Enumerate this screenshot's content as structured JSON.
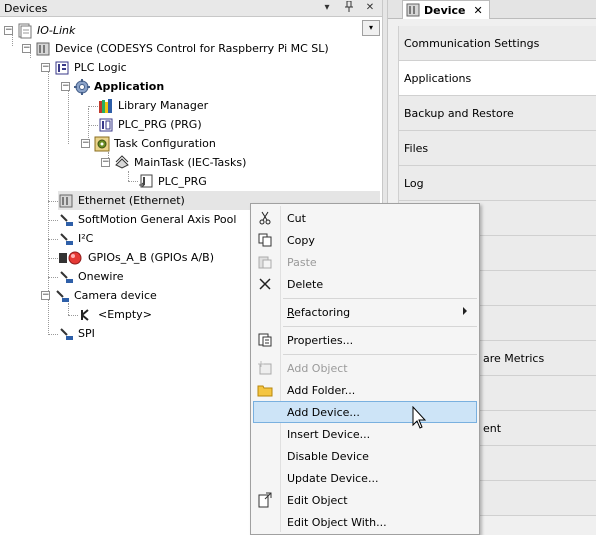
{
  "pane": {
    "title": "Devices",
    "dropdown_glyph": "▾",
    "btn_pin": "▾",
    "btn_dock": "⊥",
    "btn_close": "✕"
  },
  "tree": {
    "root": "IO-Link",
    "device": "Device (CODESYS Control for Raspberry Pi MC SL)",
    "plc_logic": "PLC Logic",
    "application": "Application",
    "library_manager": "Library Manager",
    "plc_prg": "PLC_PRG (PRG)",
    "task_configuration": "Task Configuration",
    "main_task": "MainTask (IEC-Tasks)",
    "plc_prg_call": "PLC_PRG",
    "ethernet": "Ethernet (Ethernet)",
    "softmotion": "SoftMotion General Axis Pool",
    "i2c": "I²C",
    "gpios": "GPIOs_A_B (GPIOs A/B)",
    "onewire": "Onewire",
    "camera": "Camera device",
    "empty": "<Empty>",
    "spi": "SPI"
  },
  "device_pane": {
    "tab_label": "Device",
    "tab_close": "✕",
    "nav": [
      "Communication Settings",
      "Applications",
      "Backup and Restore",
      "Files",
      "Log",
      "",
      "ps",
      "",
      "",
      "are Metrics",
      "",
      "ent",
      "",
      ""
    ]
  },
  "menu": {
    "cut": "Cut",
    "copy": "Copy",
    "paste": "Paste",
    "delete": "Delete",
    "refactoring": "Refactoring",
    "properties": "Properties...",
    "add_object": "Add Object",
    "add_folder": "Add Folder...",
    "add_device": "Add Device...",
    "insert_device": "Insert Device...",
    "disable_device": "Disable Device",
    "update_device": "Update Device...",
    "edit_object": "Edit Object",
    "edit_object_with": "Edit Object With..."
  },
  "colors": {
    "selection": "#cde4f7",
    "selection_border": "#79b0df",
    "disabled_text": "#9a9a9a"
  }
}
